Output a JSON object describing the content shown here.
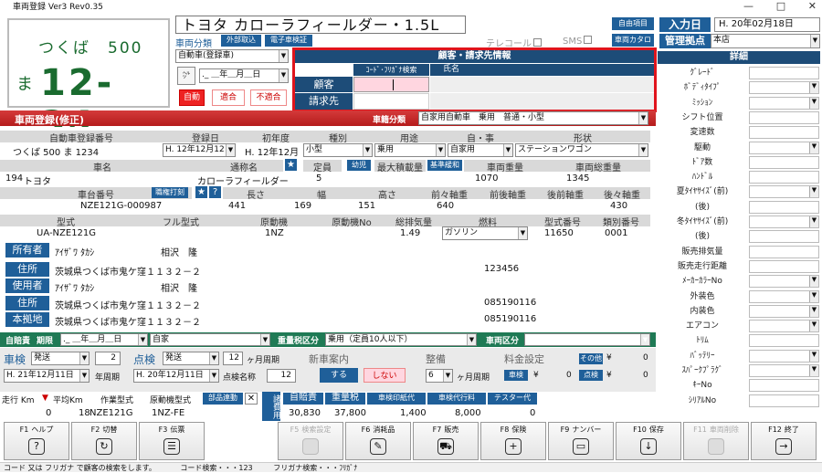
{
  "window": {
    "title": "車両登録 Ver3 Rev0.35"
  },
  "plate": {
    "line1": "つくば　500",
    "kana": "ま",
    "number": "12-34"
  },
  "car_name": "トヨタ カローラフィールダー・1.5L",
  "header": {
    "vehicle_class_label": "車両分類",
    "outside_btn": "外部取込",
    "e_cert_btn": "電子車検証",
    "class_value": "自動車(登録車)",
    "date_value": "._ ＿年＿月＿日",
    "auto_btn": "自動",
    "ok_btn": "適合",
    "ng_btn": "不適合",
    "telecall": "テレコール",
    "sms": "SMS",
    "free_item_btn": "自由項目",
    "catalog_btn": "車両カタログ",
    "entry_date_label": "入力日",
    "entry_date_value": "H. 20年02月18日",
    "base_label": "管理拠点",
    "base_value": "本店"
  },
  "customer": {
    "title": "顧客・請求先情報",
    "col_code": "ｺｰﾄﾞ･ﾌﾘｶﾞﾅ検索",
    "col_name": "氏名",
    "row1": "顧客",
    "row2": "請求先"
  },
  "reg": {
    "bar_title": "車両登録(修正)",
    "type_label": "車籍分類",
    "type_value": "自家用自動車　乗用　普通・小型",
    "h_regno": "自動車登録番号",
    "h_regdate": "登録日",
    "h_firstreg": "初年度",
    "h_kind": "種別",
    "h_usage": "用途",
    "h_jiei": "自・事",
    "h_shape": "形状",
    "regno": "つくば 500 ま 1234",
    "regdate": "H. 12年12月12日",
    "firstreg": "H. 12年12月",
    "kind": "小型",
    "usage": "乗用",
    "jiei": "自家用",
    "shape": "ステーションワゴン",
    "h_maker": "車名",
    "h_model_name": "通称名",
    "h_capacity": "定員",
    "child_btn": "幼児",
    "h_maxload": "最大積載量",
    "std_btn": "基準緩和",
    "h_weight": "車両重量",
    "h_total_weight": "車両総重量",
    "maker_code": "194",
    "maker": "トヨタ",
    "model_name": "カローラフィールダー",
    "capacity": "5",
    "weight": "1070",
    "total_weight": "1345",
    "h_chassis": "車台番号",
    "stamp_btn": "職権打刻",
    "h_length": "長さ",
    "h_width": "幅",
    "h_height": "高さ",
    "h_ff": "前々軸重",
    "h_fr": "前後軸重",
    "h_rf": "後前軸重",
    "h_rr": "後々軸重",
    "chassis": "NZE121G-000987",
    "length": "441",
    "width": "169",
    "height": "151",
    "ff": "640",
    "rr": "430",
    "h_model": "型式",
    "h_full_model": "フル型式",
    "h_engine": "原動機",
    "h_engine_no": "原動機No",
    "h_displacement": "総排気量",
    "h_fuel": "燃料",
    "h_type_no": "型式番号",
    "h_class_no": "類別番号",
    "model": "UA-NZE121G",
    "engine": "1NZ",
    "displacement": "1.49",
    "fuel": "ガソリン",
    "type_no": "11650",
    "class_no": "0001"
  },
  "owner": {
    "owner_label": "所有者",
    "owner_kana": "ｱｲｻﾞﾜ ﾀｶｼ",
    "owner_name": "相沢　隆",
    "addr_label": "住所",
    "owner_addr": "茨城県つくば市鬼ケ窪１１３２－２",
    "owner_zip": "123456",
    "user_label": "使用者",
    "user_kana": "ｱｲｻﾞﾜ ﾀｶｼ",
    "user_name": "相沢　隆",
    "user_addr": "茨城県つくば市鬼ケ窪１１３２－２",
    "user_tel": "085190116",
    "base_label": "本拠地",
    "base_addr": "茨城県つくば市鬼ケ窪１１３２－２",
    "base_tel": "085190116"
  },
  "insurance": {
    "jibai_label": "自賠責",
    "period_label": "期限",
    "period_value": "._ ＿年＿月＿日",
    "self_value": "自家",
    "weight_tax_label": "重量税区分",
    "weight_tax_value": "乗用（定員10人以下）",
    "vehicle_class_label": "車両区分"
  },
  "inspection": {
    "shaken_label": "車検",
    "shaken_select": "発送",
    "shaken_num": "2",
    "shaken_date": "H. 21年12月11日",
    "year_label": "年周期",
    "tenken_label": "点検",
    "tenken_select": "発送",
    "tenken_num": "12",
    "month_label": "ヶ月周期",
    "tenken_date": "H. 20年12月11日",
    "tenken_name_label": "点検名称",
    "tenken_name": "12",
    "newcar_label": "新車案内",
    "do_btn": "する",
    "dont_btn": "しない",
    "seibi_label": "整備",
    "seibi_value": "6",
    "seibi_unit": "ヶ月周期",
    "fee_label": "料金設定",
    "other_btn": "その他",
    "yen": "¥",
    "shaken_btn": "車検",
    "tenken_btn": "点検",
    "zero": "0"
  },
  "mileage": {
    "km_label": "走行 Km",
    "avg_label": "平均Km",
    "work_model_label": "作業型式",
    "engine_model_label": "原動機型式",
    "parts_btn": "部品連動",
    "km_value": "0",
    "avg_value": "18",
    "work_model": "NZE121G",
    "engine_model": "1NZ-FE",
    "side_label": "諸費用",
    "h1": "自賠責",
    "h2": "重量税",
    "h3": "車検印紙代",
    "h4": "車検代行料",
    "h5": "テスター代",
    "v1": "30,830",
    "v2": "37,800",
    "v3": "1,400",
    "v4": "8,000",
    "v5": "0"
  },
  "details": {
    "title": "詳細",
    "items": [
      "ｸﾞﾚｰﾄﾞ",
      "ﾎﾞﾃﾞｨﾀｲﾌﾟ",
      "ﾐｯｼｮﾝ",
      "シフト位置",
      "変速数",
      "駆動",
      "ﾄﾞｱ数",
      "ﾊﾝﾄﾞﾙ",
      "夏ﾀｲﾔｻｲｽﾞ(前)",
      "(後)",
      "冬ﾀｲﾔｻｲｽﾞ(前)",
      "(後)",
      "販売排気量",
      "販売走行距離",
      "ﾒｰｶｰｶﾗｰNo",
      "外装色",
      "内装色",
      "エアコン",
      "ﾄﾘﾑ",
      "ﾊﾞｯﾃﾘｰ",
      "ｽﾊﾟｰｸﾌﾟﾗｸﾞ",
      "ｷｰNo",
      "ｼﾘｱﾙNo"
    ]
  },
  "fkeys": [
    {
      "key": "F1",
      "label": "ヘルプ",
      "icon": "?"
    },
    {
      "key": "F2",
      "label": "切替",
      "icon": "↻"
    },
    {
      "key": "F3",
      "label": "伝票",
      "icon": "☰"
    },
    {
      "key": "F5",
      "label": "検索設定",
      "icon": ""
    },
    {
      "key": "F6",
      "label": "消耗品",
      "icon": "✎"
    },
    {
      "key": "F7",
      "label": "販売",
      "icon": "⛟"
    },
    {
      "key": "F8",
      "label": "保険",
      "icon": "+"
    },
    {
      "key": "F9",
      "label": "ナンバー",
      "icon": "▭"
    },
    {
      "key": "F10",
      "label": "保存",
      "icon": "↓"
    },
    {
      "key": "F11",
      "label": "車両削除",
      "icon": ""
    },
    {
      "key": "F12",
      "label": "終了",
      "icon": "→"
    }
  ],
  "status": {
    "left": "コード 又は フリガナ で顧客の検索をします。",
    "mid": "コード検索・・・123",
    "right": "フリガナ検索・・・ﾌﾘｶﾞﾅ"
  }
}
